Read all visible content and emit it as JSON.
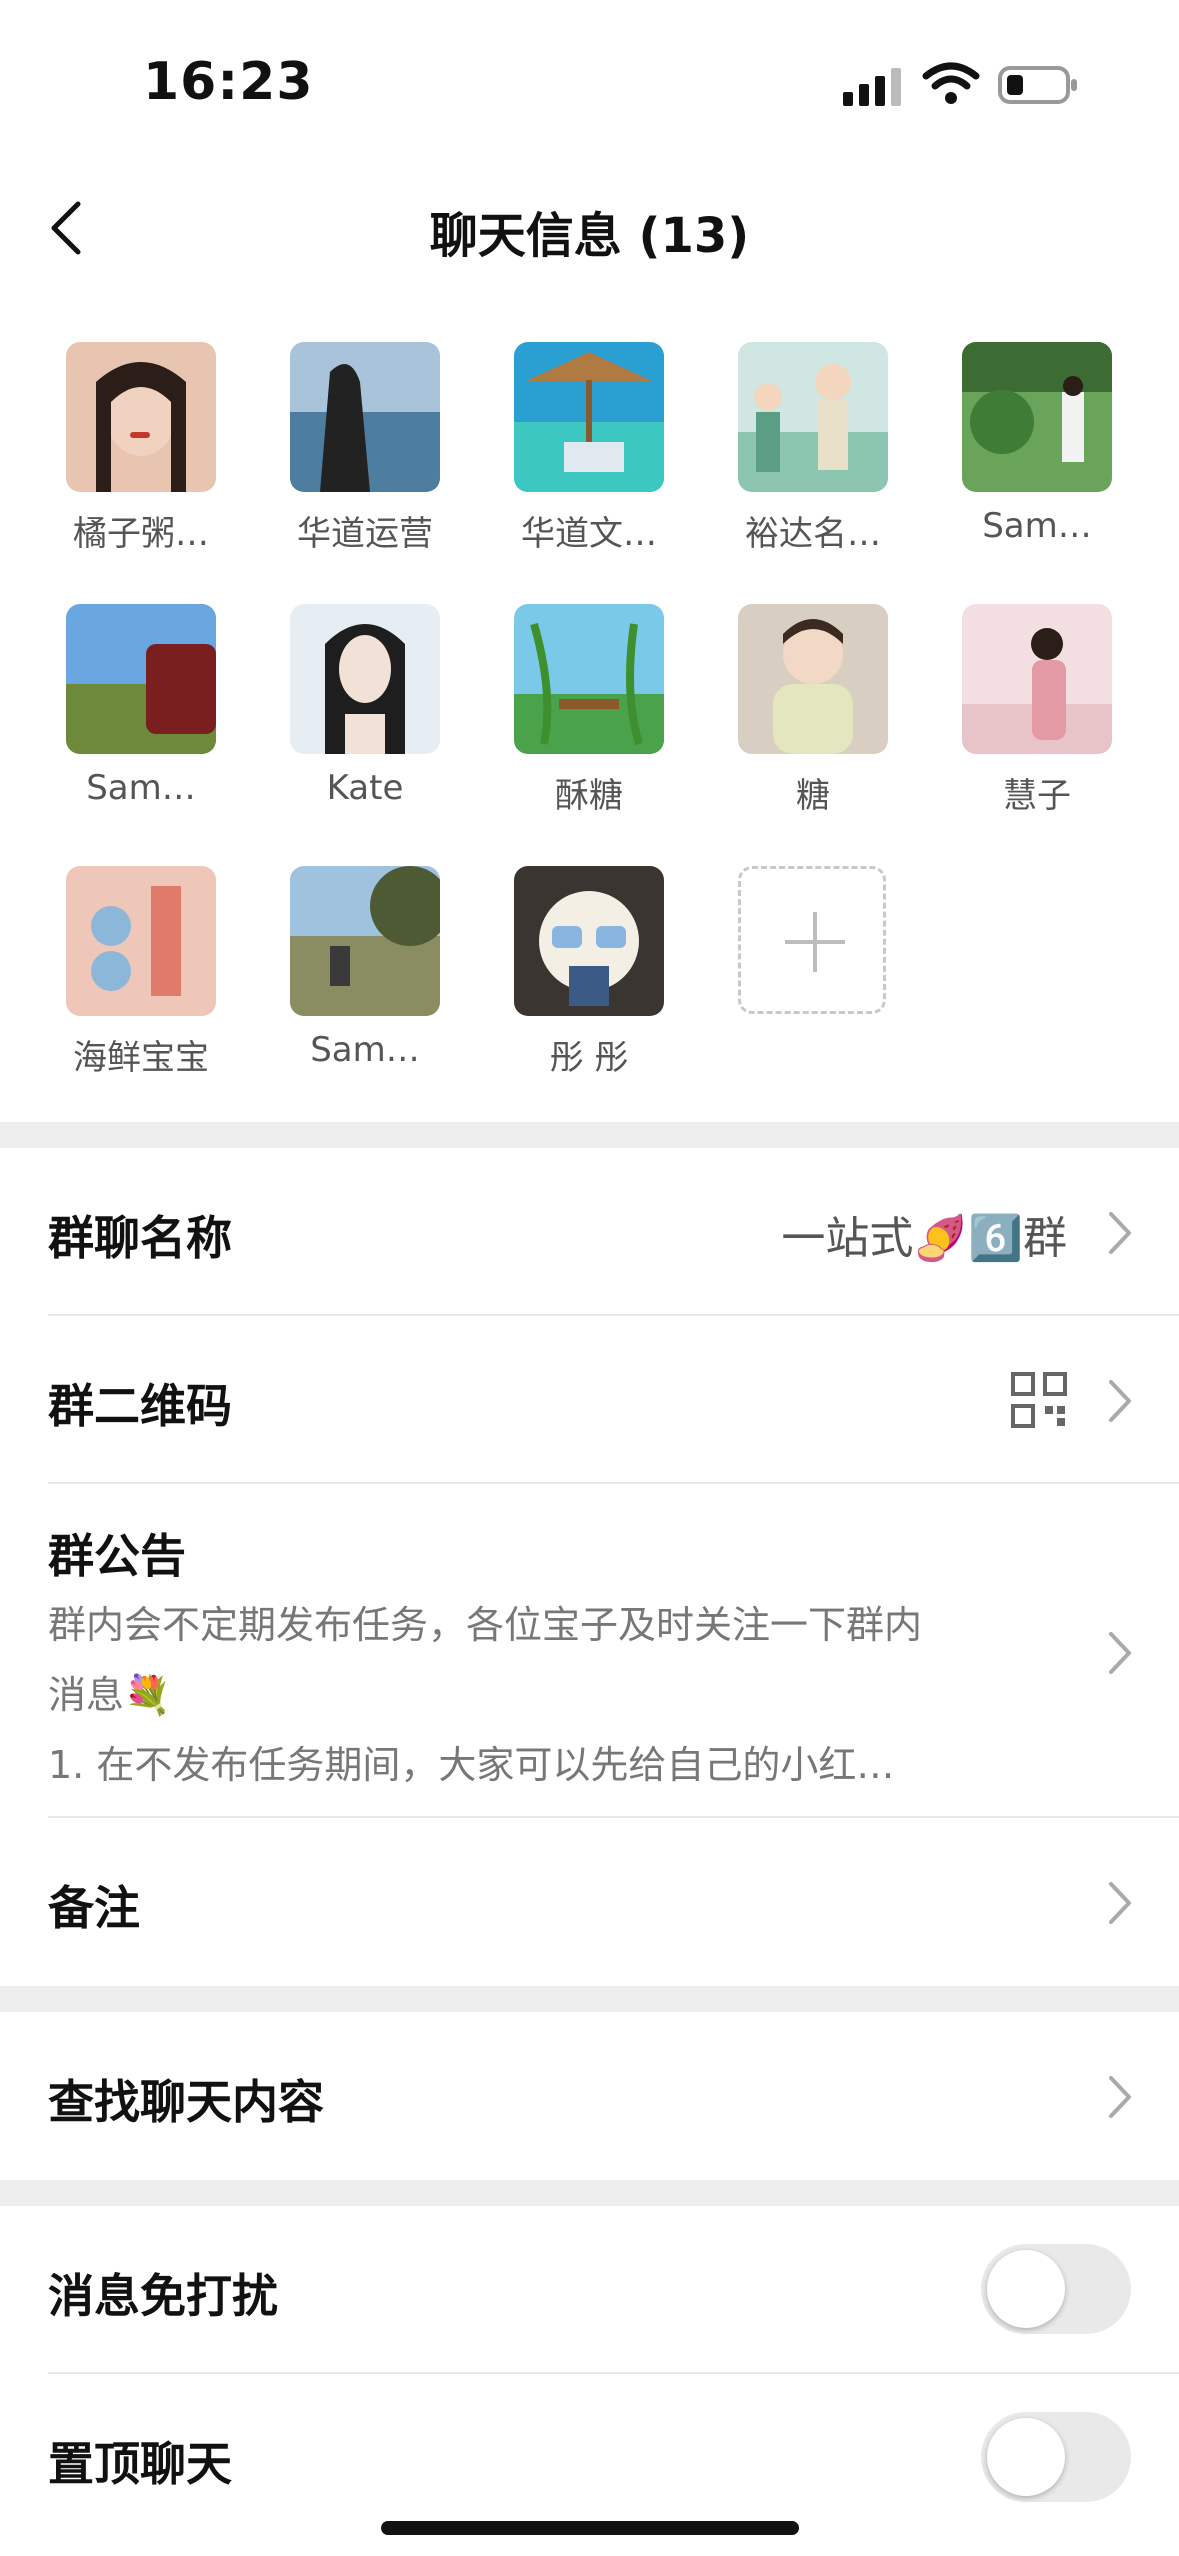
{
  "status_bar": {
    "time": "16:23"
  },
  "nav": {
    "title": "聊天信息 (13)"
  },
  "members": [
    {
      "name": "橘子粥…",
      "avatar_color": "#c98a7a"
    },
    {
      "name": "华道运营",
      "avatar_color": "#6f8fa8"
    },
    {
      "name": "华道文…",
      "avatar_color": "#3fb3c9"
    },
    {
      "name": "裕达名…",
      "avatar_color": "#8cc6b0"
    },
    {
      "name": "Sam…",
      "avatar_color": "#4f8a3c"
    },
    {
      "name": "Sam…",
      "avatar_color": "#4d86c8"
    },
    {
      "name": "Kate",
      "avatar_color": "#b9c7d4"
    },
    {
      "name": "酥糖",
      "avatar_color": "#5fb858"
    },
    {
      "name": "糖",
      "avatar_color": "#d8c9a8"
    },
    {
      "name": "慧子",
      "avatar_color": "#e6b7c0"
    },
    {
      "name": "海鲜宝宝",
      "avatar_color": "#e0a79a"
    },
    {
      "name": "Sam…",
      "avatar_color": "#7e8d6a"
    },
    {
      "name": "彤 彤",
      "avatar_color": "#3a3530"
    }
  ],
  "settings": {
    "group_name": {
      "label": "群聊名称",
      "value": "一站式🍠6️⃣群"
    },
    "qr_code": {
      "label": "群二维码"
    },
    "notice": {
      "label": "群公告",
      "line1": "群内会不定期发布任务，各位宝子及时关注一下群内",
      "line2": "消息💐",
      "line3": "1. 在不发布任务期间，大家可以先给自己的小红…"
    },
    "remark": {
      "label": "备注"
    },
    "search": {
      "label": "查找聊天内容"
    },
    "mute": {
      "label": "消息免打扰",
      "on": false
    },
    "pin": {
      "label": "置顶聊天",
      "on": false
    }
  },
  "colors": {
    "background": "#ffffff",
    "separator": "#ededed",
    "toggle_off": "#e9e9e9"
  }
}
